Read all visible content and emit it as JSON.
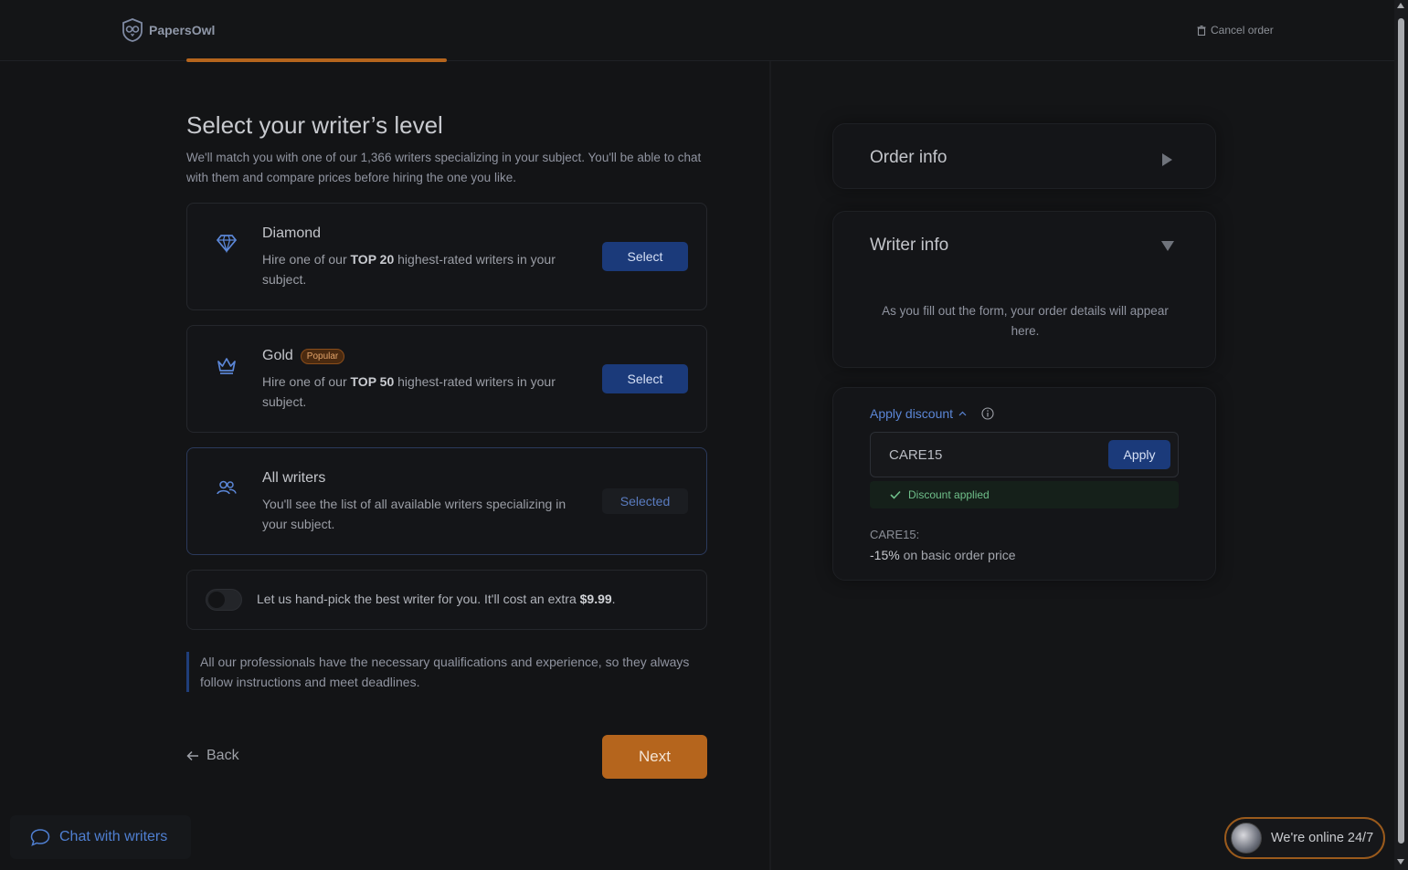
{
  "header": {
    "brand": "PapersOwl",
    "cancel_label": "Cancel order",
    "progress": 0.25
  },
  "main": {
    "title": "Select your writer’s level",
    "subtitle": "We'll match you with one of our 1,366 writers specializing in your subject. You'll be able to chat with them and compare prices before hiring the one you like.",
    "levels": [
      {
        "name": "Diamond",
        "desc_pre": "Hire one of our ",
        "desc_bold": "TOP 20",
        "desc_post": " highest-rated writers in your subject.",
        "button": "Select",
        "icon": "diamond-icon"
      },
      {
        "name": "Gold",
        "badge": "Popular",
        "desc_pre": "Hire one of our ",
        "desc_bold": "TOP 50",
        "desc_post": " highest-rated writers in your subject.",
        "button": "Select",
        "icon": "crown-icon"
      },
      {
        "name": "All writers",
        "desc": "You'll see the list of all available writers specializing in your subject.",
        "button": "Selected",
        "icon": "users-icon"
      }
    ],
    "handpick": {
      "text": "Let us hand-pick the best writer for you. It'll cost an extra ",
      "price": "$9.99",
      "suffix": ".",
      "enabled": false
    },
    "note": "All our professionals have the necessary qualifications and experience, so they always follow instructions and meet deadlines.",
    "back_label": "Back",
    "next_label": "Next"
  },
  "sidebar": {
    "order_info": "Order info",
    "writer_info": "Writer info",
    "writer_hint": "As you fill out the form, your order details will appear here.",
    "discount": {
      "link": "Apply discount",
      "code": "CARE15",
      "apply_label": "Apply",
      "status": "Discount applied",
      "code_label": "CARE15:",
      "amount": "-15%",
      "amount_desc": " on basic order price"
    }
  },
  "footer": {
    "chat_label": "Chat with writers",
    "online_label": "We're online 24/7"
  },
  "colors": {
    "accent": "#b5651d",
    "primary": "#1b3a7a",
    "link": "#5b86d6",
    "success": "#6fbf8a"
  }
}
